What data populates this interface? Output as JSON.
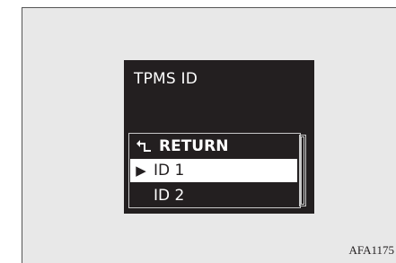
{
  "display": {
    "title": "TPMS ID",
    "menu": {
      "items": [
        {
          "label": "RETURN",
          "icon": "return-arrow-icon"
        },
        {
          "label": "ID 1",
          "icon": "right-triangle-icon",
          "selected": true
        },
        {
          "label": "ID 2"
        }
      ]
    }
  },
  "figure_code": "AFA1175"
}
